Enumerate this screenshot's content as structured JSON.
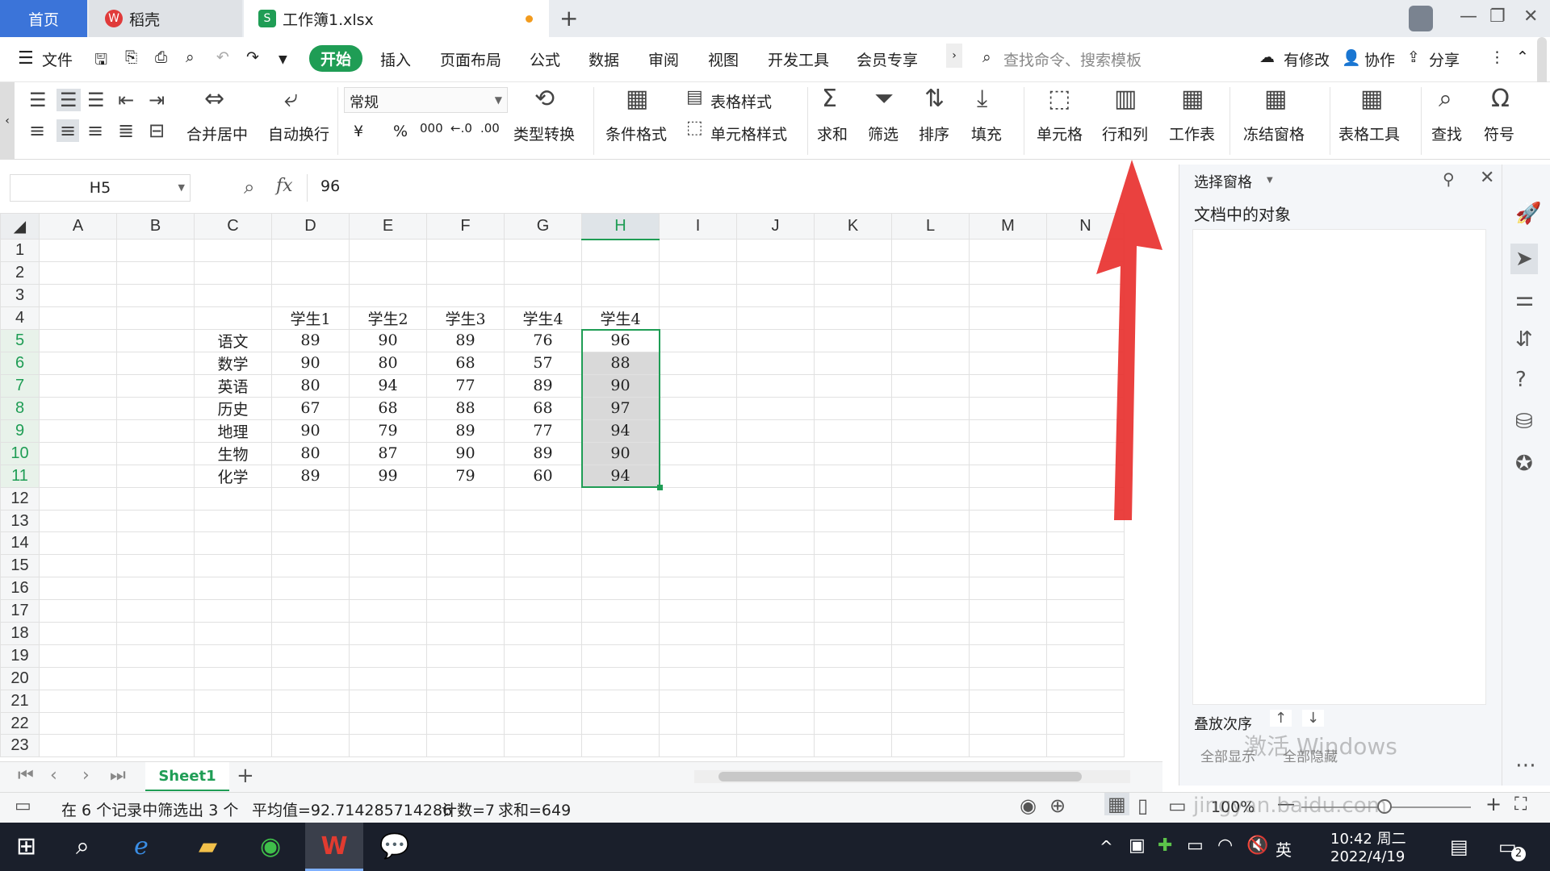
{
  "tabs": {
    "home": "首页",
    "daoke": "稻壳",
    "file": "工作簿1.xlsx",
    "add": "+"
  },
  "menu": {
    "file": "文件",
    "start": "开始",
    "insert": "插入",
    "layout": "页面布局",
    "formula": "公式",
    "data": "数据",
    "review": "审阅",
    "view": "视图",
    "dev": "开发工具",
    "vip": "会员专享",
    "search_placeholder": "查找命令、搜索模板",
    "modify": "有修改",
    "collab": "协作",
    "share": "分享"
  },
  "ribbon": {
    "merge": "合并居中",
    "wrap": "自动换行",
    "format": "常规",
    "convert": "类型转换",
    "cond": "条件格式",
    "table_style": "表格样式",
    "cell_style": "单元格样式",
    "sum": "求和",
    "filter": "筛选",
    "sort": "排序",
    "fill": "填充",
    "cell": "单元格",
    "rowcol": "行和列",
    "sheet": "工作表",
    "freeze": "冻结窗格",
    "tools": "表格工具",
    "find": "查找",
    "symbol": "符号",
    "currency": "¥",
    "percent": "%",
    "thousand": "000"
  },
  "formula_bar": {
    "cell_ref": "H5",
    "fx": "fx",
    "value": "96"
  },
  "columns": [
    "A",
    "B",
    "C",
    "D",
    "E",
    "F",
    "G",
    "H",
    "I",
    "J",
    "K",
    "L",
    "M",
    "N"
  ],
  "rows": [
    "1",
    "2",
    "3",
    "4",
    "5",
    "6",
    "7",
    "8",
    "9",
    "10",
    "11",
    "12",
    "13",
    "14",
    "15",
    "16",
    "17",
    "18",
    "19",
    "20",
    "21",
    "22",
    "23"
  ],
  "table": {
    "headers": [
      "学生1",
      "学生2",
      "学生3",
      "学生4",
      "学生4"
    ],
    "subjects": [
      "语文",
      "数学",
      "英语",
      "历史",
      "地理",
      "生物",
      "化学"
    ],
    "values": [
      [
        "89",
        "90",
        "89",
        "76",
        "96"
      ],
      [
        "90",
        "80",
        "68",
        "57",
        "88"
      ],
      [
        "80",
        "94",
        "77",
        "89",
        "90"
      ],
      [
        "67",
        "68",
        "88",
        "68",
        "97"
      ],
      [
        "90",
        "79",
        "89",
        "77",
        "94"
      ],
      [
        "80",
        "87",
        "90",
        "89",
        "90"
      ],
      [
        "89",
        "99",
        "79",
        "60",
        "94"
      ]
    ]
  },
  "pane": {
    "title": "选择窗格",
    "objects": "文档中的对象",
    "order": "叠放次序",
    "show_all": "全部显示",
    "hide_all": "全部隐藏"
  },
  "sheet_tab": "Sheet1",
  "status": {
    "filter": "在 6 个记录中筛选出 3 个",
    "average": "平均值=92.714285714286",
    "count": "计数=7",
    "sum": "求和=649",
    "zoom": "100%"
  },
  "taskbar": {
    "time": "10:42 周二",
    "date": "2022/4/19",
    "lang": "英",
    "notif": "2"
  },
  "watermark": {
    "activate": "激活 Windows",
    "site": "jingyan.baidu.com"
  },
  "colors": {
    "accent": "#1f9d55",
    "home_tab": "#3b74d9",
    "arrow": "#e8312f"
  }
}
